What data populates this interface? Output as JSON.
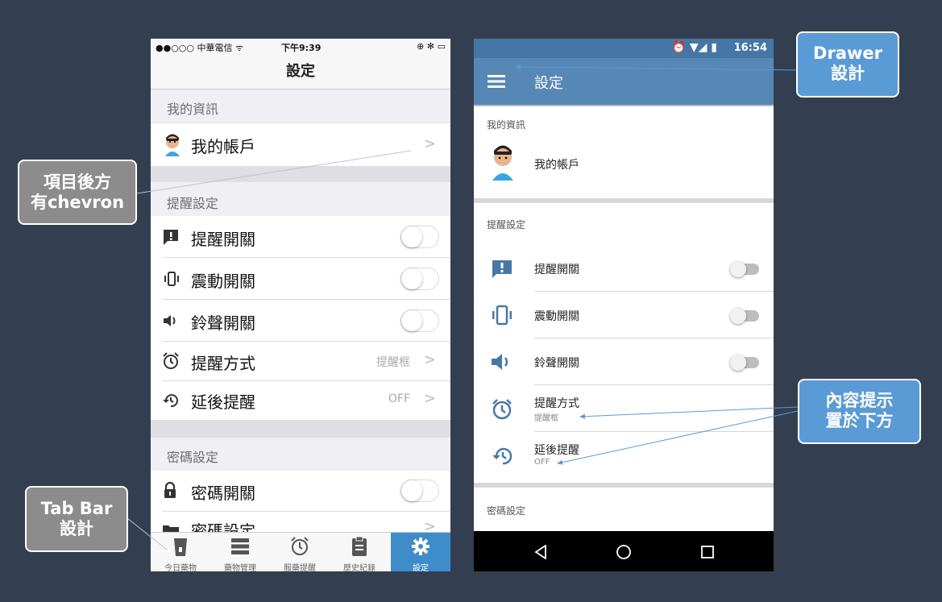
{
  "ios": {
    "status": {
      "carrier": "●●○○○ 中華電信 ᯤ",
      "time": "下午9:39",
      "right": "⊕ ✻ ▭"
    },
    "nav_title": "設定",
    "sections": {
      "info": "我的資訊",
      "reminder": "提醒設定",
      "password": "密碼設定"
    },
    "rows": {
      "account": "我的帳戶",
      "reminder_switch": "提醒開關",
      "vibrate_switch": "震動開關",
      "ring_switch": "鈴聲開關",
      "reminder_mode": "提醒方式",
      "reminder_mode_value": "提醒框",
      "snooze": "延後提醒",
      "snooze_value": "OFF",
      "password_switch": "密碼開關",
      "password_settings": "密碼設定"
    },
    "tabs": [
      "今日藥物",
      "藥物管理",
      "服藥提醒",
      "歷史紀錄",
      "設定"
    ],
    "active_tab": 4
  },
  "android": {
    "status_time": "16:54",
    "toolbar_title": "設定",
    "sections": {
      "info": "我的資訊",
      "reminder": "提醒設定",
      "password": "密碼設定"
    },
    "rows": {
      "account": "我的帳戶",
      "reminder_switch": "提醒開關",
      "vibrate_switch": "震動開關",
      "ring_switch": "鈴聲開關",
      "reminder_mode": "提醒方式",
      "reminder_mode_value": "提醒框",
      "snooze": "延後提醒",
      "snooze_value": "OFF"
    }
  },
  "callouts": {
    "chevron": [
      "項目後方",
      "有chevron"
    ],
    "tabbar": [
      "Tab Bar",
      "設計"
    ],
    "drawer": [
      "Drawer",
      "設計"
    ],
    "content_hint": [
      "內容提示",
      "置於下方"
    ]
  },
  "colors": {
    "background": "#333f50",
    "ios_accent": "#3f8ccb",
    "android_toolbar": "#5787b5",
    "callout_blue": "#5b9bd5",
    "callout_gray": "#8c8c8c"
  }
}
